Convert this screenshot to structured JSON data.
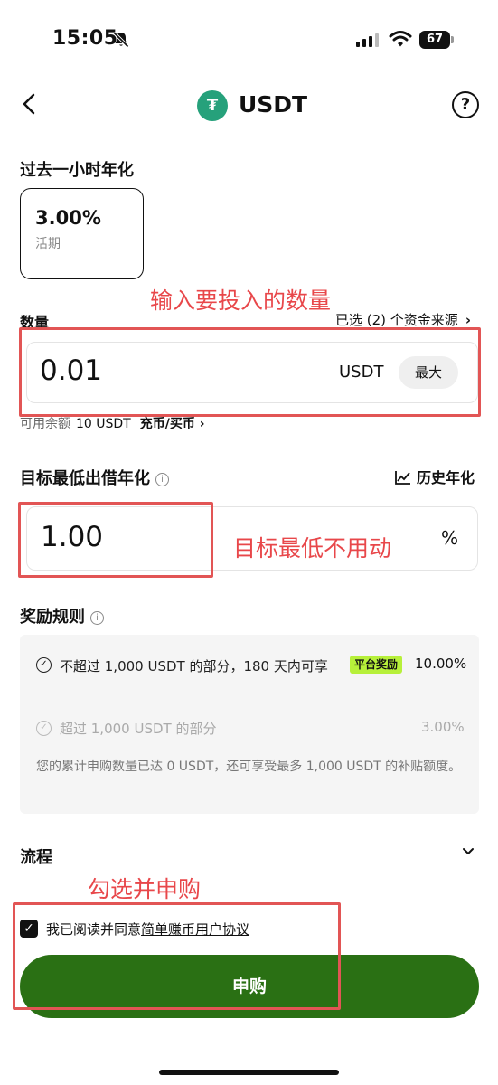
{
  "status_bar": {
    "time": "15:05",
    "battery": "67",
    "icons": [
      "bell-slash-icon",
      "signal-icon",
      "wifi-icon",
      "battery-icon"
    ]
  },
  "header": {
    "title": "USDT",
    "coin_symbol": "₮",
    "coin_color": "#26a17b",
    "back_icon": "chevron-left-icon",
    "help_label": "?"
  },
  "apy": {
    "section_label": "过去一小时年化",
    "value": "3.00%",
    "type": "活期"
  },
  "amount": {
    "section_label": "数量",
    "source_link": "已选 (2) 个资金来源",
    "value": "0.01",
    "unit": "USDT",
    "max_label": "最大",
    "balance_label": "可用余额",
    "balance_value": "10 USDT",
    "topup_link": "充币/买币 ›"
  },
  "target_rate": {
    "section_label": "目标最低出借年化",
    "history_link": "历史年化",
    "value": "1.00",
    "unit": "%"
  },
  "rewards": {
    "section_label": "奖励规则",
    "rule_1_text": "不超过 1,000 USDT 的部分，180 天内可享",
    "rule_1_badge": "平台奖励",
    "rule_1_rate": "10.00%",
    "rule_2_text": "超过 1,000 USDT 的部分",
    "rule_2_rate": "3.00%",
    "note": "您的累计申购数量已达 0 USDT，还可享受最多 1,000 USDT 的补贴额度。"
  },
  "flow": {
    "label": "流程"
  },
  "agreement": {
    "checked": true,
    "prefix": "我已阅读并同意",
    "link": "简单赚币用户协议"
  },
  "submit_label": "申购",
  "annotations": {
    "amount_note": "输入要投入的数量",
    "rate_note": "目标最低不用动",
    "submit_note": "勾选并申购",
    "color": "#e8474a"
  }
}
